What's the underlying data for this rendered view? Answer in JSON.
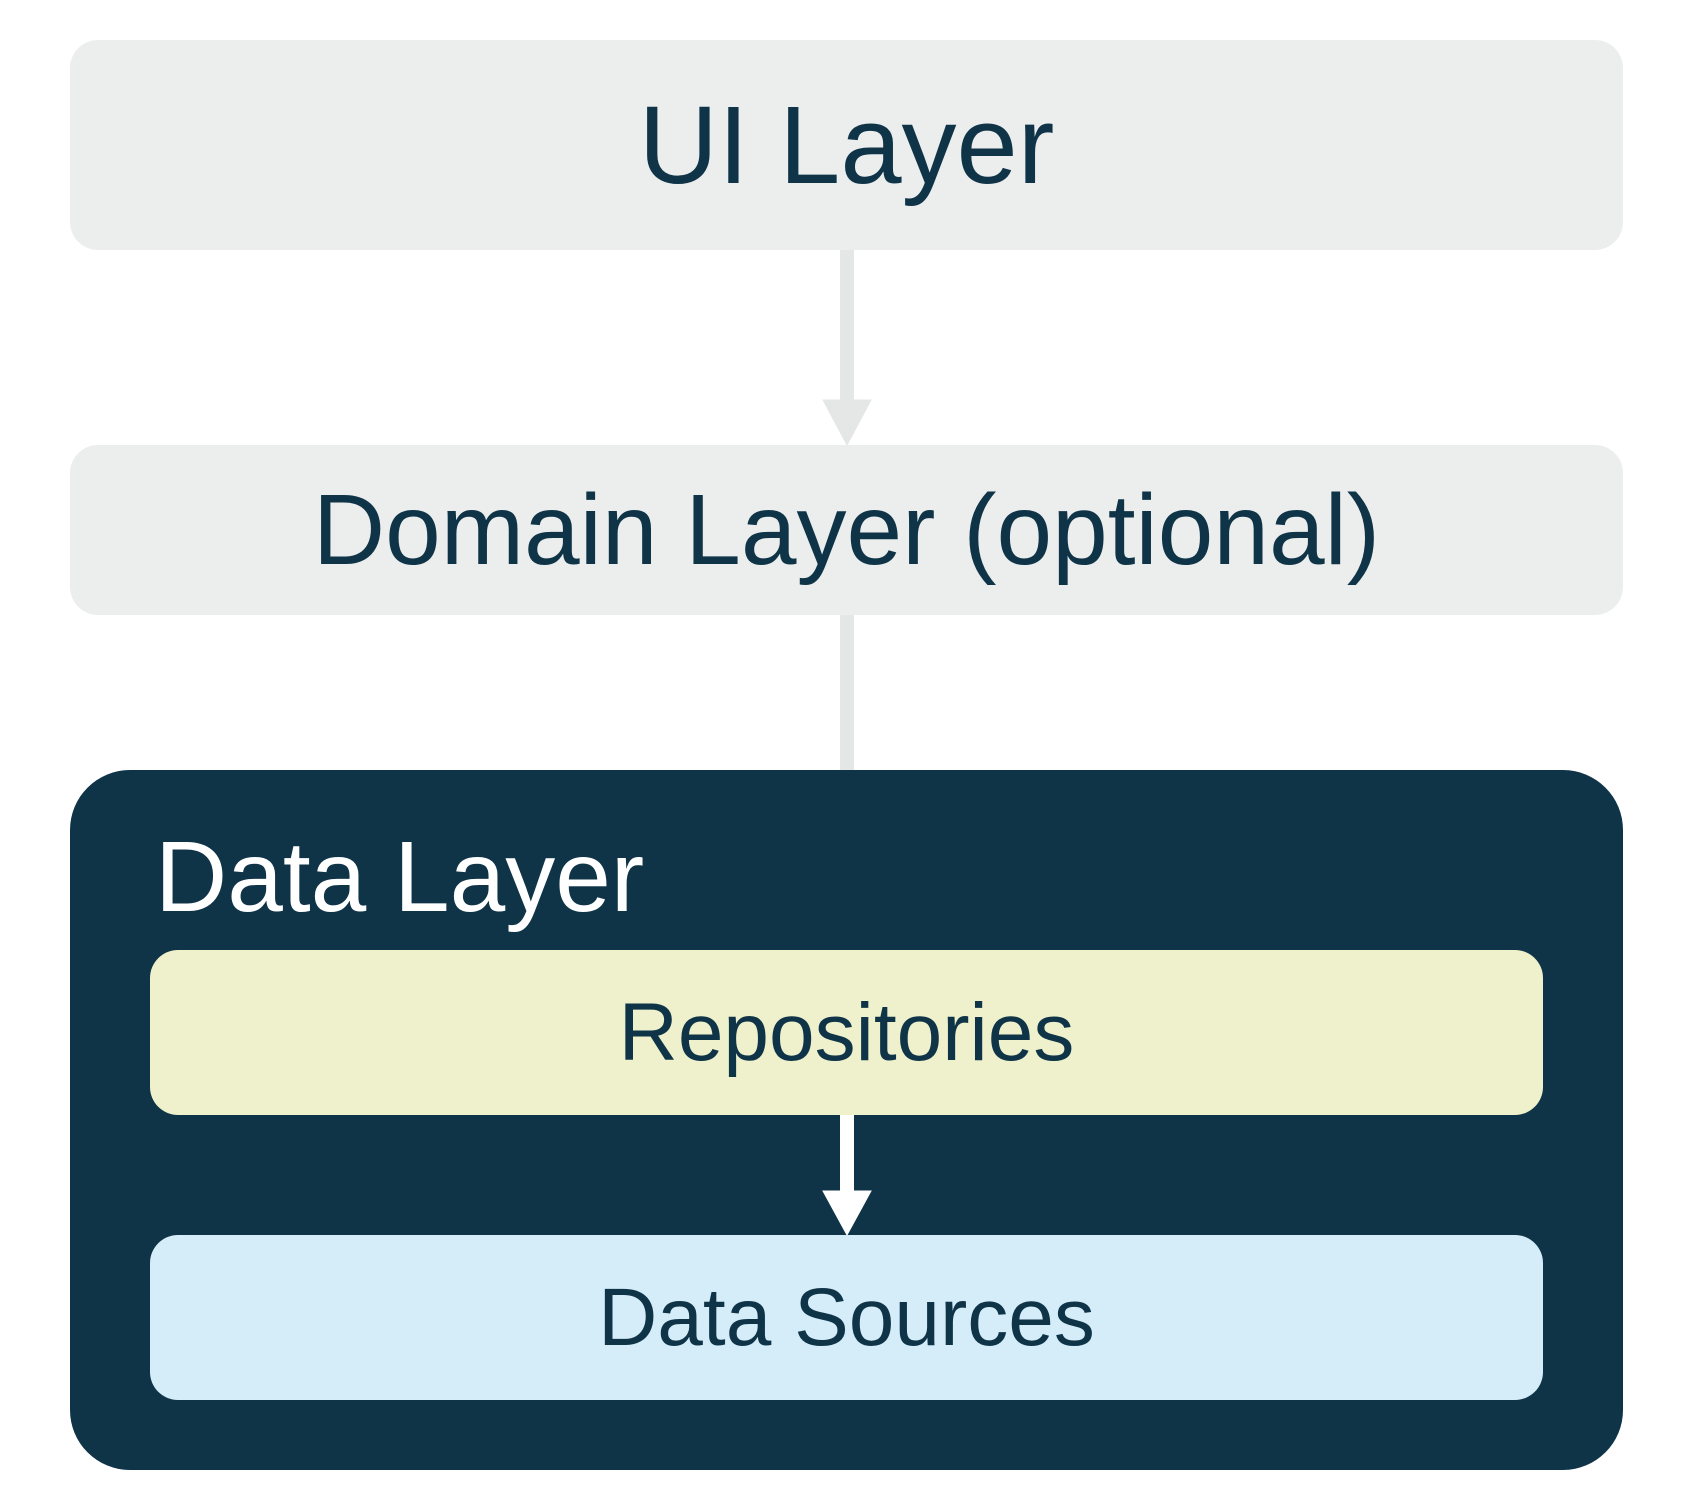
{
  "layers": {
    "ui": "UI Layer",
    "domain": "Domain Layer (optional)",
    "data_title": "Data Layer",
    "repositories": "Repositories",
    "data_sources": "Data Sources"
  },
  "colors": {
    "box_gray": "#eceded",
    "text_dark": "#0f3448",
    "panel_dark": "#0f3448",
    "repositories_bg": "#eef1cb",
    "data_sources_bg": "#d5ecf9",
    "arrow_gray": "#e5e6e6",
    "arrow_white": "#ffffff"
  },
  "diagram": {
    "type": "layered-architecture",
    "nodes": [
      {
        "id": "ui",
        "label": "UI Layer"
      },
      {
        "id": "domain",
        "label": "Domain Layer (optional)"
      },
      {
        "id": "data",
        "label": "Data Layer",
        "children": [
          "repositories",
          "data_sources"
        ]
      },
      {
        "id": "repositories",
        "label": "Repositories",
        "parent": "data"
      },
      {
        "id": "data_sources",
        "label": "Data Sources",
        "parent": "data"
      }
    ],
    "edges": [
      {
        "from": "ui",
        "to": "domain"
      },
      {
        "from": "domain",
        "to": "repositories"
      },
      {
        "from": "repositories",
        "to": "data_sources"
      }
    ]
  }
}
